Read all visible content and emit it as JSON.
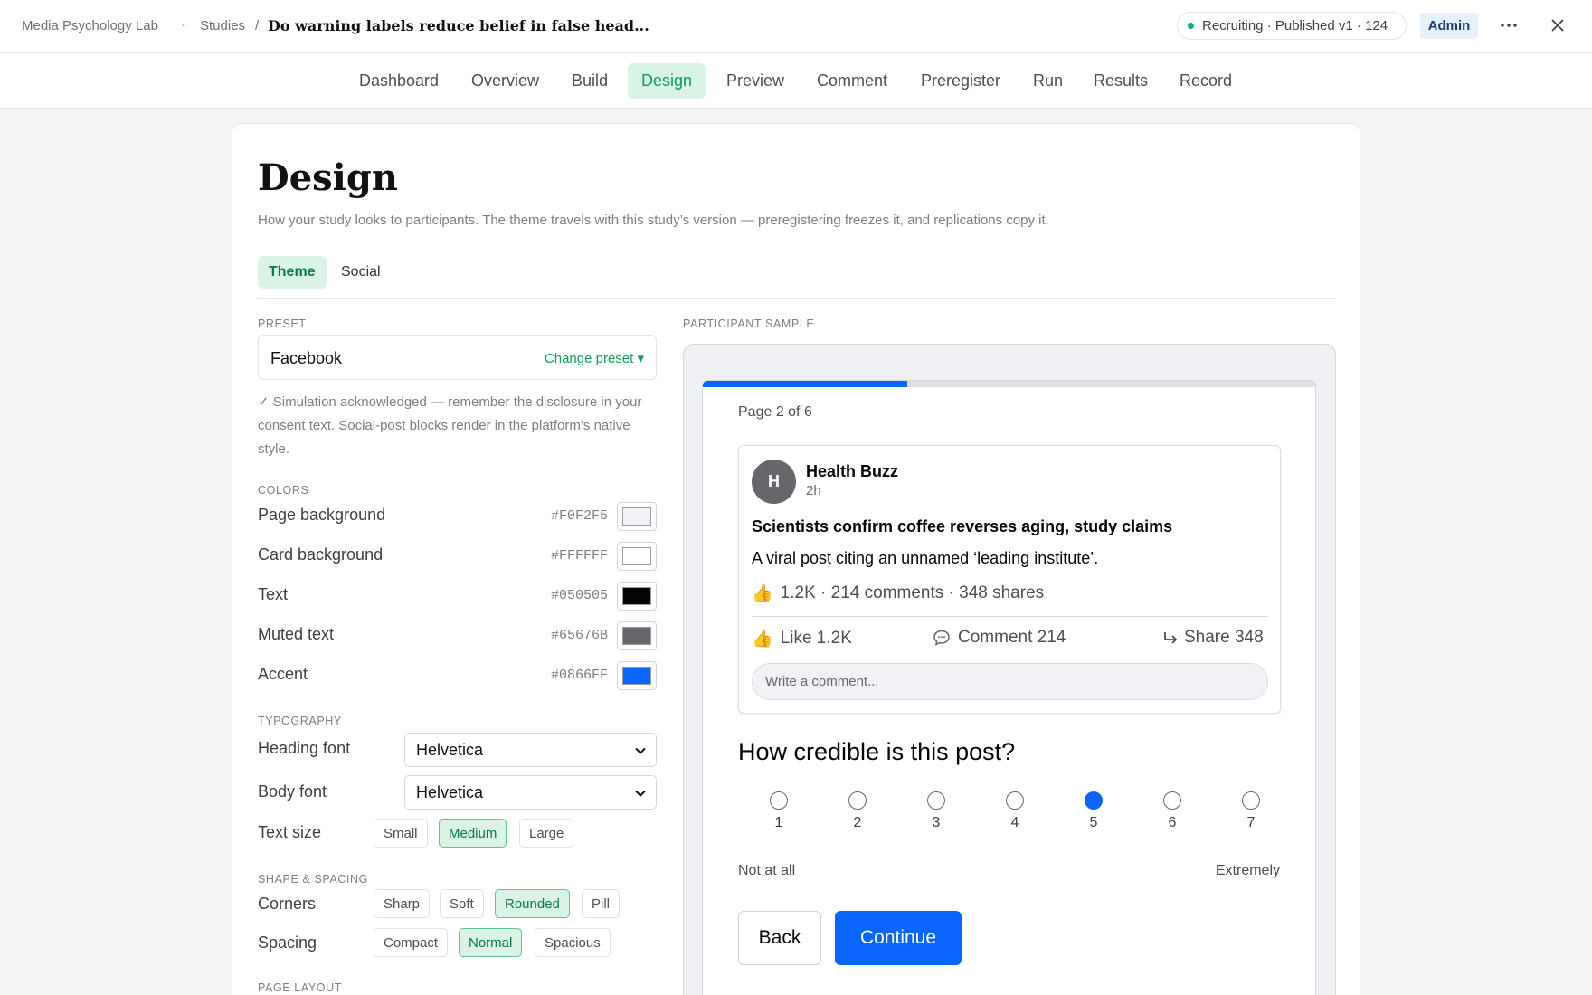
{
  "breadcrumb": {
    "lab": "Media Psychology Lab",
    "separator_dot": "·",
    "studies": "Studies",
    "slash": "/",
    "study_title": "Do warning labels reduce belief in false head..."
  },
  "header": {
    "status": "Recruiting · Published v1 · 124",
    "status_color": "#10B26C",
    "role": "Admin",
    "icons": [
      "more-horizontal-icon",
      "close-icon"
    ]
  },
  "nav": {
    "tabs": [
      {
        "label": "Dashboard"
      },
      {
        "label": "Overview"
      },
      {
        "label": "Build"
      },
      {
        "label": "Design",
        "active": true
      },
      {
        "label": "Preview"
      },
      {
        "label": "Comment"
      },
      {
        "label": "Preregister"
      },
      {
        "label": "Run"
      },
      {
        "label": "Results"
      },
      {
        "label": "Record"
      }
    ]
  },
  "page": {
    "title": "Design",
    "description": "How your study looks to participants. The theme travels with this study’s version — preregistering freezes it, and replications copy it.",
    "subtabs": [
      {
        "label": "Theme",
        "active": true
      },
      {
        "label": "Social"
      }
    ]
  },
  "theme": {
    "preset_label": "Preset",
    "preset_value": "Facebook",
    "change_preset": "Change preset ▾",
    "preset_note": "✓ Simulation acknowledged — remember the disclosure in your consent text. Social-post blocks render in the platform’s native style.",
    "colors_label": "Colors",
    "colors": [
      {
        "label": "Page background",
        "hex": "#F0F2F5"
      },
      {
        "label": "Card background",
        "hex": "#FFFFFF"
      },
      {
        "label": "Text",
        "hex": "#050505"
      },
      {
        "label": "Muted text",
        "hex": "#65676B"
      },
      {
        "label": "Accent",
        "hex": "#0866FF"
      }
    ],
    "typography_label": "Typography",
    "heading_font_label": "Heading font",
    "heading_font": "Helvetica",
    "body_font_label": "Body font",
    "body_font": "Helvetica",
    "text_size_label": "Text size",
    "text_sizes": [
      "Small",
      "Medium",
      "Large"
    ],
    "text_size_selected": "Medium",
    "shape_label": "Shape & spacing",
    "corners_label": "Corners",
    "corners": [
      "Sharp",
      "Soft",
      "Rounded",
      "Pill"
    ],
    "corners_selected": "Rounded",
    "spacing_label": "Spacing",
    "spacings": [
      "Compact",
      "Normal",
      "Spacious"
    ],
    "spacing_selected": "Normal",
    "page_layout_label": "Page layout"
  },
  "sample": {
    "label": "Participant sample",
    "progress_fraction": 0.333,
    "page_count": "Page 2 of 6",
    "post": {
      "avatar_initial": "H",
      "author": "Health Buzz",
      "time": "2h",
      "headline": "Scientists confirm coffee reverses aging, study claims",
      "body": "A viral post citing an unnamed ‘leading institute’.",
      "stats": "1.2K · 214 comments · 348 shares",
      "like": "Like 1.2K",
      "comment": "Comment 214",
      "share": "Share 348",
      "comment_placeholder": "Write a comment..."
    },
    "question": "How credible is this post?",
    "scale": [
      "1",
      "2",
      "3",
      "4",
      "5",
      "6",
      "7"
    ],
    "scale_selected": "5",
    "scale_low": "Not at all",
    "scale_high": "Extremely",
    "back": "Back",
    "continue": "Continue"
  }
}
